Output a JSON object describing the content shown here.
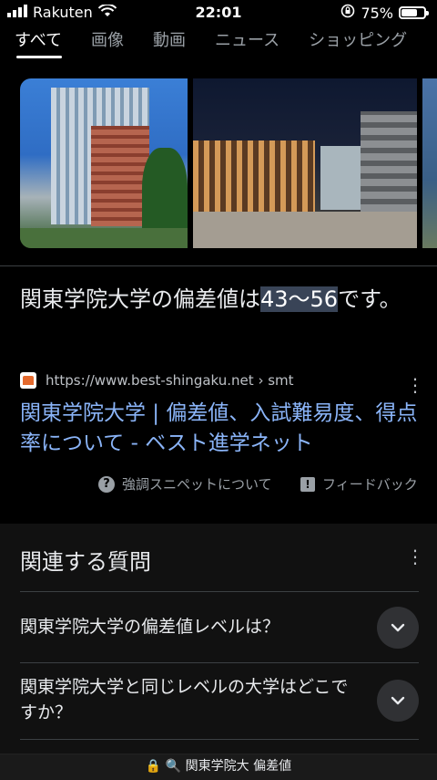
{
  "status_bar": {
    "carrier": "Rakuten",
    "time": "22:01",
    "battery": "75%",
    "battery_level": 0.75
  },
  "tabs": [
    {
      "label": "すべて",
      "active": true
    },
    {
      "label": "画像"
    },
    {
      "label": "動画"
    },
    {
      "label": "ニュース"
    },
    {
      "label": "ショッピング"
    }
  ],
  "snippet": {
    "text_before": "関東学院大学の偏差値は",
    "highlight": "43〜56",
    "text_after": "です。",
    "source_url": "https://www.best-shingaku.net",
    "source_path": "› smt",
    "link_title": "関東学院大学 | 偏差値、入試難易度、得点率について - ベスト進学ネット",
    "about_label": "強調スニペットについて",
    "feedback_label": "フィードバック"
  },
  "related": {
    "title": "関連する質問",
    "questions": [
      "関東学院大学の偏差値レベルは？",
      "関東学院大学と同じレベルの大学はどこですか？"
    ]
  },
  "address_bar": {
    "query": "関東学院大 偏差値"
  }
}
